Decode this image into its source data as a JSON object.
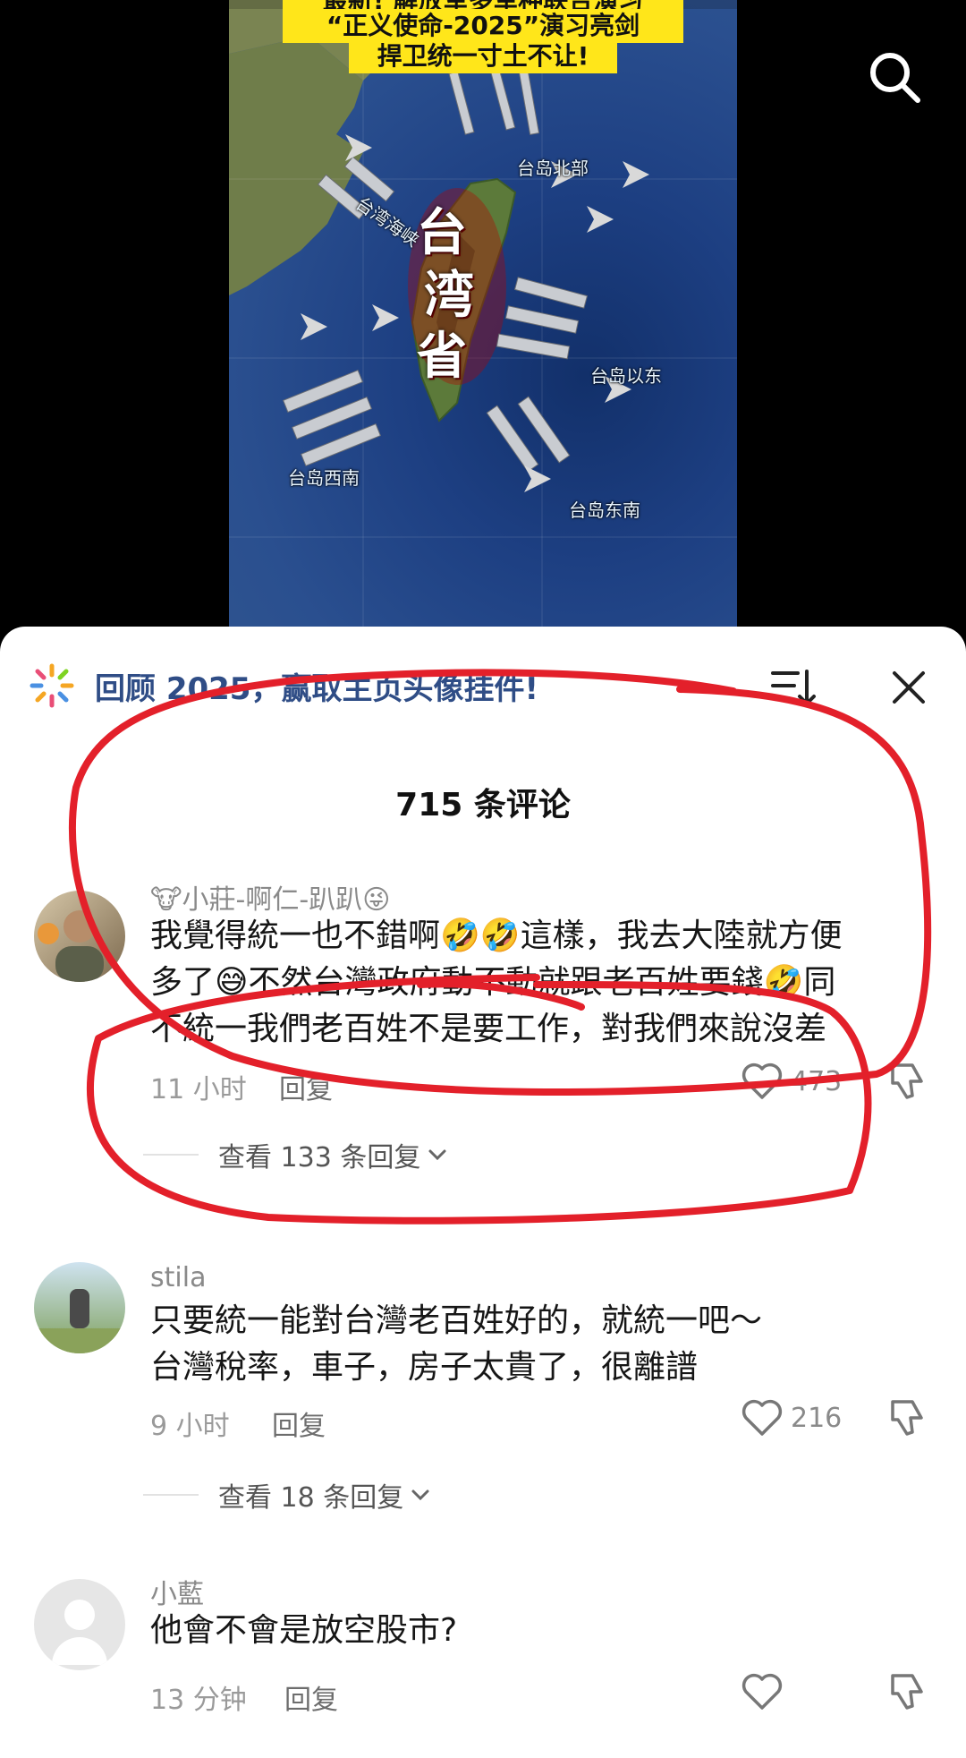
{
  "video": {
    "banner_line_top": "最新! 解放军多军种联合演习",
    "banner_line1": "“正义使命-2025”演习亮剑",
    "banner_line2": "捍卫统一寸土不让!",
    "big_label_chars": [
      "台",
      "湾",
      "省"
    ],
    "labels": {
      "strait": "台湾海峡",
      "north": "台岛北部",
      "east": "台岛以东",
      "southwest": "台岛西南",
      "southeast": "台岛东南"
    },
    "search_icon": "search-icon"
  },
  "sheet": {
    "promo_text": "回顾 2025，赢取主页头像挂件!",
    "promo_icon": "sparkle-icon",
    "sort_icon": "sort-icon",
    "close_icon": "close-icon",
    "comment_count": "715 条评论"
  },
  "comments": [
    {
      "user": "🐮小莊-啊仁-趴趴😜",
      "lines": [
        "我覺得統一也不錯啊🤣🤣這樣，我去大陸就方便",
        "多了😅不然台灣政府動不動就跟老百姓要錢🤣同",
        "不統一我們老百姓不是要工作，對我們來說沒差"
      ],
      "time": "11 小时",
      "reply_label": "回复",
      "likes": "473",
      "view_replies": "查看 133 条回复"
    },
    {
      "user": "stila",
      "lines": [
        "只要統一能對台灣老百姓好的，就統一吧～",
        "台灣稅率，車子，房子太貴了，很離譜"
      ],
      "time": "9 小时",
      "reply_label": "回复",
      "likes": "216",
      "view_replies": "查看 18 条回复"
    },
    {
      "user": "小藍",
      "lines": [
        "他會不會是放空股市?"
      ],
      "time": "13 分钟",
      "reply_label": "回复",
      "likes": "",
      "view_replies": ""
    }
  ],
  "colors": {
    "accent_blue": "#2f4d86",
    "annotation_red": "#e3202a",
    "banner_yellow": "#ffe61a"
  }
}
